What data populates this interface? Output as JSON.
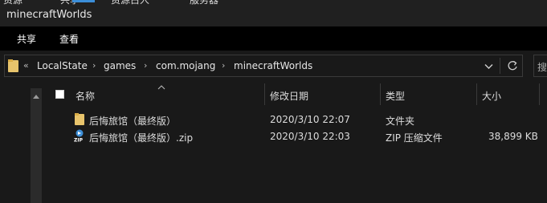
{
  "window": {
    "title": "minecraftWorlds",
    "top_clipped": [
      "资源",
      "共享",
      "资源占人",
      "服务器"
    ]
  },
  "ribbon": {
    "tabs": [
      "共享",
      "查看"
    ]
  },
  "address": {
    "overflow": "«",
    "crumbs": [
      "LocalState",
      "games",
      "com.mojang",
      "minecraftWorlds"
    ],
    "search_hint": "搜"
  },
  "columns": {
    "name": "名称",
    "date": "修改日期",
    "type": "类型",
    "size": "大小"
  },
  "files": [
    {
      "name": "后悔旅馆（最终版）",
      "date": "2020/3/10 22:07",
      "type": "文件夹",
      "size": "",
      "icon": "folder-icon"
    },
    {
      "name": "后悔旅馆（最终版）.zip",
      "date": "2020/3/10 22:03",
      "type": "ZIP 压缩文件",
      "size": "38,899 KB",
      "icon": "zip-icon"
    }
  ],
  "colors": {
    "background": "#191919",
    "ribbon": "#000000",
    "folder": "#e8c46c",
    "zip": "#3d8fd8"
  }
}
